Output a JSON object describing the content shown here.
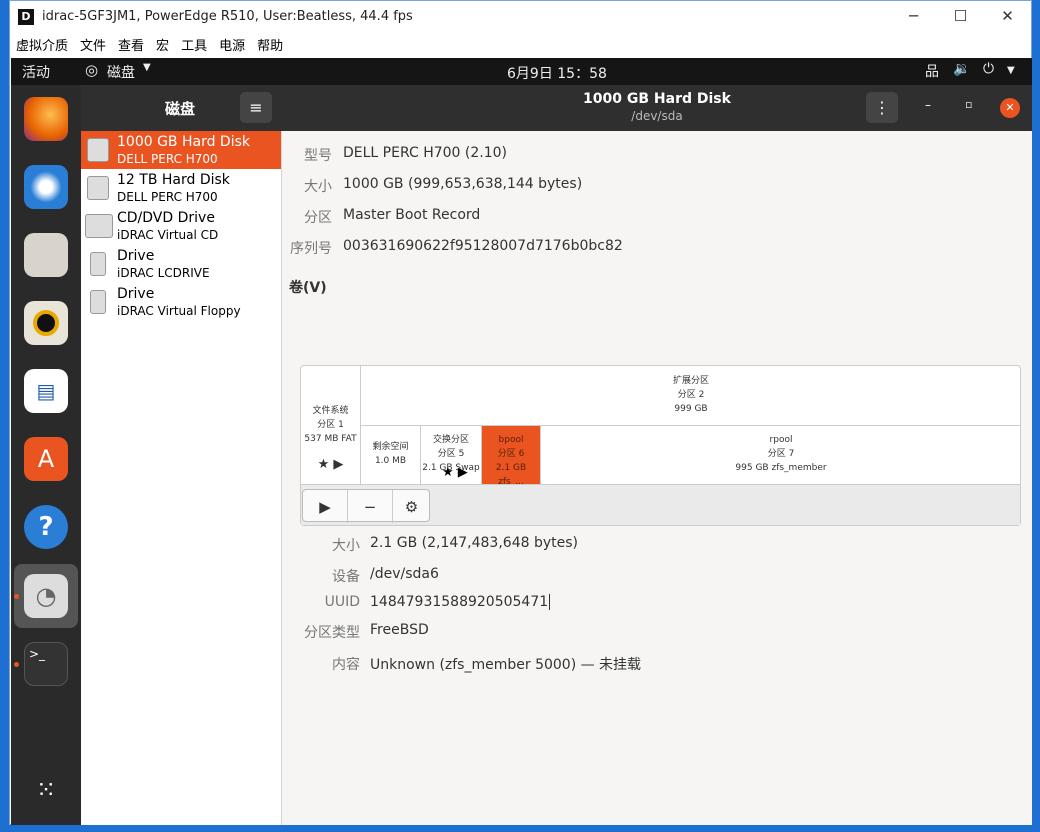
{
  "window": {
    "title": "idrac-5GF3JM1, PowerEdge R510, User:Beatless, 44.4 fps",
    "app_icon": "D"
  },
  "menu": [
    "虚拟介质",
    "文件",
    "查看",
    "宏",
    "工具",
    "电源",
    "帮助"
  ],
  "topbar": {
    "activities": "活动",
    "app_name": "磁盘",
    "clock": "6月9日 15：58"
  },
  "sidebar": {
    "title": "磁盘",
    "disks": [
      {
        "name": "1000 GB Hard Disk",
        "sub": "DELL PERC H700",
        "selected": true
      },
      {
        "name": "12 TB Hard Disk",
        "sub": "DELL PERC H700"
      },
      {
        "name": "CD/DVD Drive",
        "sub": "iDRAC Virtual CD"
      },
      {
        "name": "Drive",
        "sub": "iDRAC LCDRIVE"
      },
      {
        "name": "Drive",
        "sub": "iDRAC Virtual Floppy"
      }
    ]
  },
  "header": {
    "title": "1000 GB Hard Disk",
    "subtitle": "/dev/sda"
  },
  "info": {
    "model_label": "型号",
    "model": "DELL PERC H700 (2.10)",
    "size_label": "大小",
    "size": "1000 GB (999,653,638,144 bytes)",
    "partitioning_label": "分区",
    "partitioning": "Master Boot Record",
    "serial_label": "序列号",
    "serial": "003631690622f95128007d7176b0bc82"
  },
  "volumes_title": "卷(V)",
  "volumes": {
    "p1": [
      "文件系统",
      "分区 1",
      "537 MB FAT"
    ],
    "ext": [
      "扩展分区",
      "分区 2",
      "999 GB"
    ],
    "free": [
      "剩余空间",
      "1.0 MB"
    ],
    "p5": [
      "交换分区",
      "分区 5",
      "2.1 GB Swap"
    ],
    "p6": [
      "bpool",
      "分区 6",
      "2.1 GB zfs_..."
    ],
    "p7": [
      "rpool",
      "分区 7",
      "995 GB zfs_member"
    ]
  },
  "details": {
    "size_label": "大小",
    "size": "2.1 GB (2,147,483,648 bytes)",
    "device_label": "设备",
    "device": "/dev/sda6",
    "uuid_label": "UUID",
    "uuid": "14847931588920505471",
    "type_label": "分区类型",
    "type": "FreeBSD",
    "content_label": "内容",
    "content": "Unknown (zfs_member 5000) — 未挂载"
  },
  "colors": {
    "accent": "#e95420",
    "dark": "#2f2f2f"
  }
}
